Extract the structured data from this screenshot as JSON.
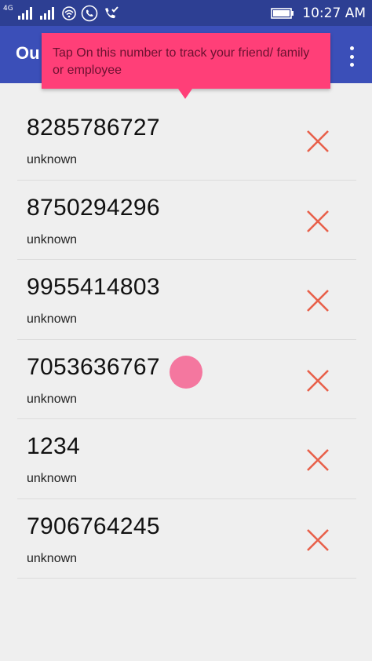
{
  "status_bar": {
    "network_label": "4G",
    "time": "10:27 AM"
  },
  "app_bar": {
    "title": "Ou"
  },
  "tooltip": {
    "text": "Tap On this number to track your friend/ family or employee"
  },
  "contacts": [
    {
      "number": "8285786727",
      "label": "unknown"
    },
    {
      "number": "8750294296",
      "label": "unknown"
    },
    {
      "number": "9955414803",
      "label": "unknown"
    },
    {
      "number": "7053636767",
      "label": "unknown"
    },
    {
      "number": "1234",
      "label": "unknown"
    },
    {
      "number": "7906764245",
      "label": "unknown"
    }
  ],
  "colors": {
    "status_bar": "#2d3f93",
    "app_bar": "#3b4fb8",
    "tooltip": "#ff3f78",
    "delete_icon": "#e8604a",
    "touch_indicator": "#f4779f"
  },
  "icons": {
    "delete": "close-icon",
    "menu": "overflow-menu-icon"
  }
}
